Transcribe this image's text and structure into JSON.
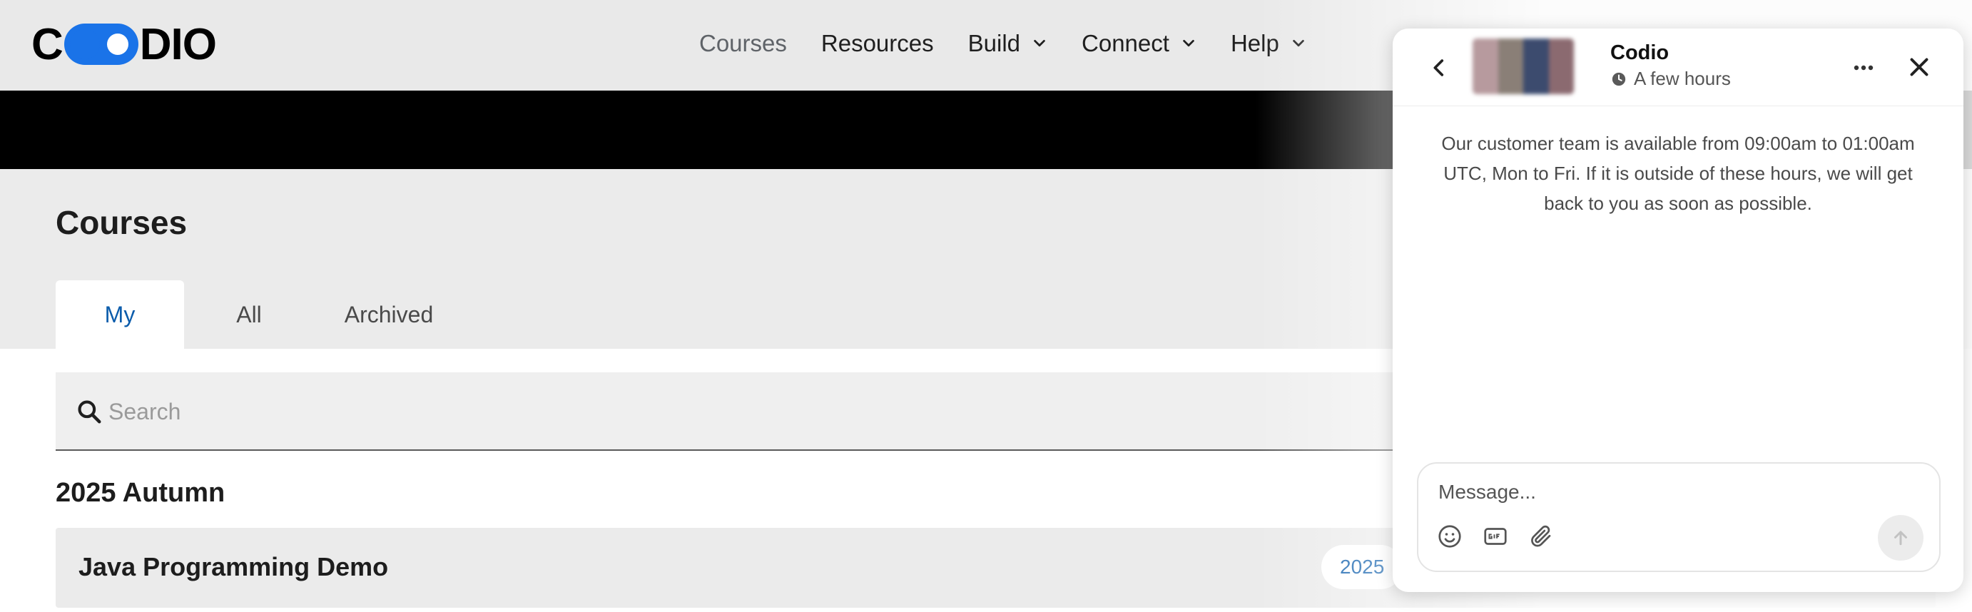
{
  "logo": {
    "text_left": "C",
    "text_right": "DIO",
    "brand_color": "#1a73e8"
  },
  "nav": {
    "items": [
      {
        "label": "Courses",
        "dropdown": false,
        "active": true
      },
      {
        "label": "Resources",
        "dropdown": false
      },
      {
        "label": "Build",
        "dropdown": true
      },
      {
        "label": "Connect",
        "dropdown": true
      },
      {
        "label": "Help",
        "dropdown": true
      }
    ]
  },
  "page": {
    "title": "Courses",
    "tabs": [
      {
        "label": "My",
        "active": true
      },
      {
        "label": "All"
      },
      {
        "label": "Archived"
      }
    ],
    "search": {
      "placeholder": "Search",
      "value": ""
    },
    "section_title": "2025 Autumn",
    "courses": [
      {
        "name": "Java Programming Demo",
        "year_badge": "2025"
      }
    ],
    "accent_color": "#0b5cab"
  },
  "chat": {
    "team_name": "Codio",
    "status": "A few hours",
    "availability_message": "Our customer team is available from 09:00am to 01:00am UTC, Mon to Fri. If it is outside of these hours, we will get back to you as soon as possible.",
    "composer": {
      "placeholder": "Message...",
      "value": ""
    },
    "icons": [
      "back-icon",
      "more-icon",
      "close-icon",
      "emoji-icon",
      "gif-icon",
      "attachment-icon",
      "send-arrow-icon"
    ]
  }
}
